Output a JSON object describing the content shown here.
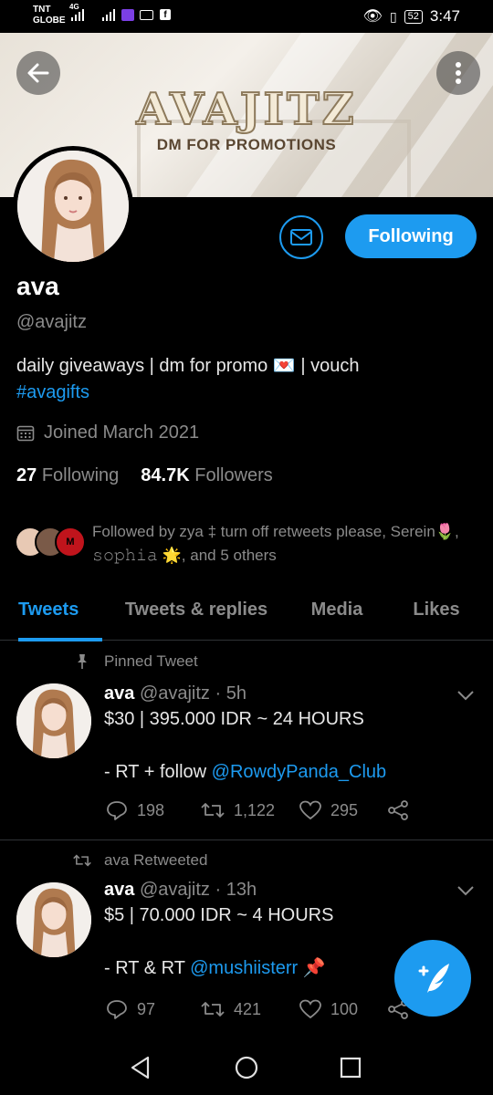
{
  "status_bar": {
    "carrier_line1": "TNT",
    "carrier_line2": "GLOBE",
    "network": "4G",
    "battery": "52",
    "time": "3:47"
  },
  "banner": {
    "title": "AVAJITZ",
    "subtitle": "DM FOR PROMOTIONS"
  },
  "profile": {
    "follow_button": "Following",
    "name": "ava",
    "handle": "@avajitz",
    "bio_text": "daily giveaways | dm for promo 💌 | vouch",
    "bio_hashtag": "#avagifts",
    "joined": "Joined March 2021",
    "following_count": "27",
    "following_label": "Following",
    "followers_count": "84.7K",
    "followers_label": "Followers",
    "followed_by": "Followed by zya ‡ turn off retweets please, Serein🌷, 𝚜𝚘𝚙𝚑𝚒𝚊 🌟, and 5 others"
  },
  "tabs": [
    "Tweets",
    "Tweets & replies",
    "Media",
    "Likes"
  ],
  "tweets": [
    {
      "context": "Pinned Tweet",
      "context_icon": "pin-icon",
      "name": "ava",
      "handle": "@avajitz",
      "time": "· 5h",
      "line1": "$30 | 395.000 IDR ~ 24 HOURS",
      "line2_prefix": "- RT + follow ",
      "line2_mention": "@RowdyPanda_Club",
      "line2_suffix": "",
      "replies": "198",
      "retweets": "1,122",
      "likes": "295"
    },
    {
      "context": "ava Retweeted",
      "context_icon": "retweet-icon",
      "name": "ava",
      "handle": "@avajitz",
      "time": "· 13h",
      "line1": "$5 | 70.000 IDR ~ 4 HOURS",
      "line2_prefix": "- RT & RT ",
      "line2_mention": "@mushiisterr",
      "line2_suffix": " 📌",
      "replies": "97",
      "retweets": "421",
      "likes": "100"
    }
  ],
  "colors": {
    "accent": "#1d9bf0",
    "background": "#000000",
    "muted_text": "#8b8b8b"
  }
}
